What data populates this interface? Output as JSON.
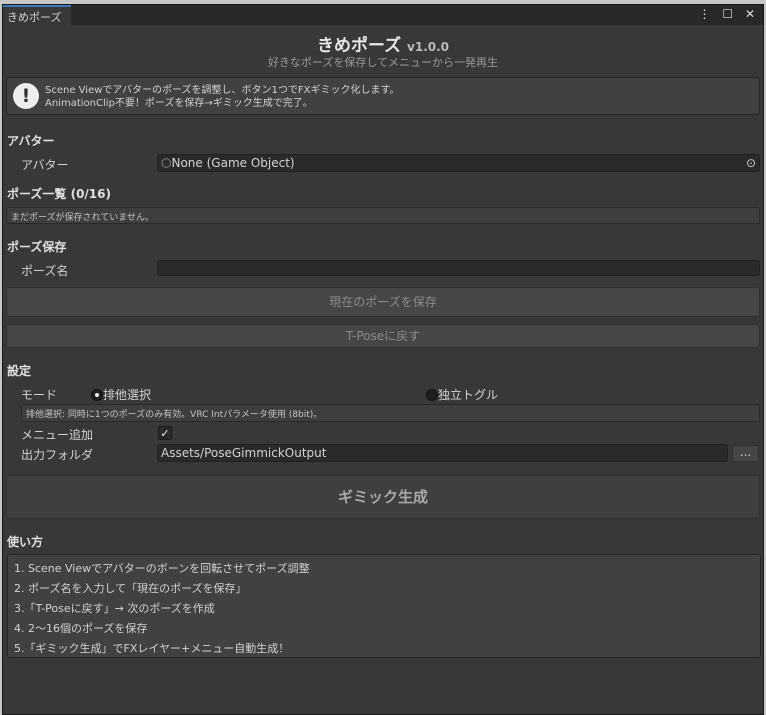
{
  "window": {
    "tab": "きめポーズ",
    "menu_icon": "⋮",
    "maximize_icon": "☐",
    "close_icon": "✕"
  },
  "header": {
    "title": "きめポーズ",
    "version": "v1.0.0",
    "subtitle": "好きなポーズを保存してメニューから一発再生"
  },
  "help": {
    "icon": "!",
    "line1": "Scene Viewでアバターのポーズを調整し、ボタン1つでFXギミック化します。",
    "line2": "AnimationClip不要！ポーズを保存→ギミック生成で完了。"
  },
  "avatar": {
    "section": "アバター",
    "label": "アバター",
    "value": "None (Game Object)"
  },
  "pose_list": {
    "section": "ポーズ一覧 (0/16)",
    "empty": "まだポーズが保存されていません。"
  },
  "pose_save": {
    "section": "ポーズ保存",
    "name_label": "ポーズ名",
    "name_value": "",
    "save_button": "現在のポーズを保存",
    "tpose_button": "T-Poseに戻す"
  },
  "settings": {
    "section": "設定",
    "mode_label": "モード",
    "mode_options": [
      "排他選択",
      "独立トグル"
    ],
    "mode_selected": "排他選択",
    "mode_info": "排他選択: 同時に1つのポーズのみ有効。VRC Intパラメータ使用 (8bit)。",
    "menu_label": "メニュー追加",
    "menu_checked": true,
    "check_glyph": "✓",
    "folder_label": "出力フォルダ",
    "folder_value": "Assets/PoseGimmickOutput",
    "browse": "..."
  },
  "generate_button": "ギミック生成",
  "usage": {
    "section": "使い方",
    "steps": [
      "1. Scene Viewでアバターのボーンを回転させてポーズ調整",
      "2. ポーズ名を入力して「現在のポーズを保存」",
      "3.「T-Poseに戻す」→ 次のポーズを作成",
      "4. 2〜16個のポーズを保存",
      "5.「ギミック生成」でFXレイヤー+メニュー自動生成！"
    ]
  }
}
